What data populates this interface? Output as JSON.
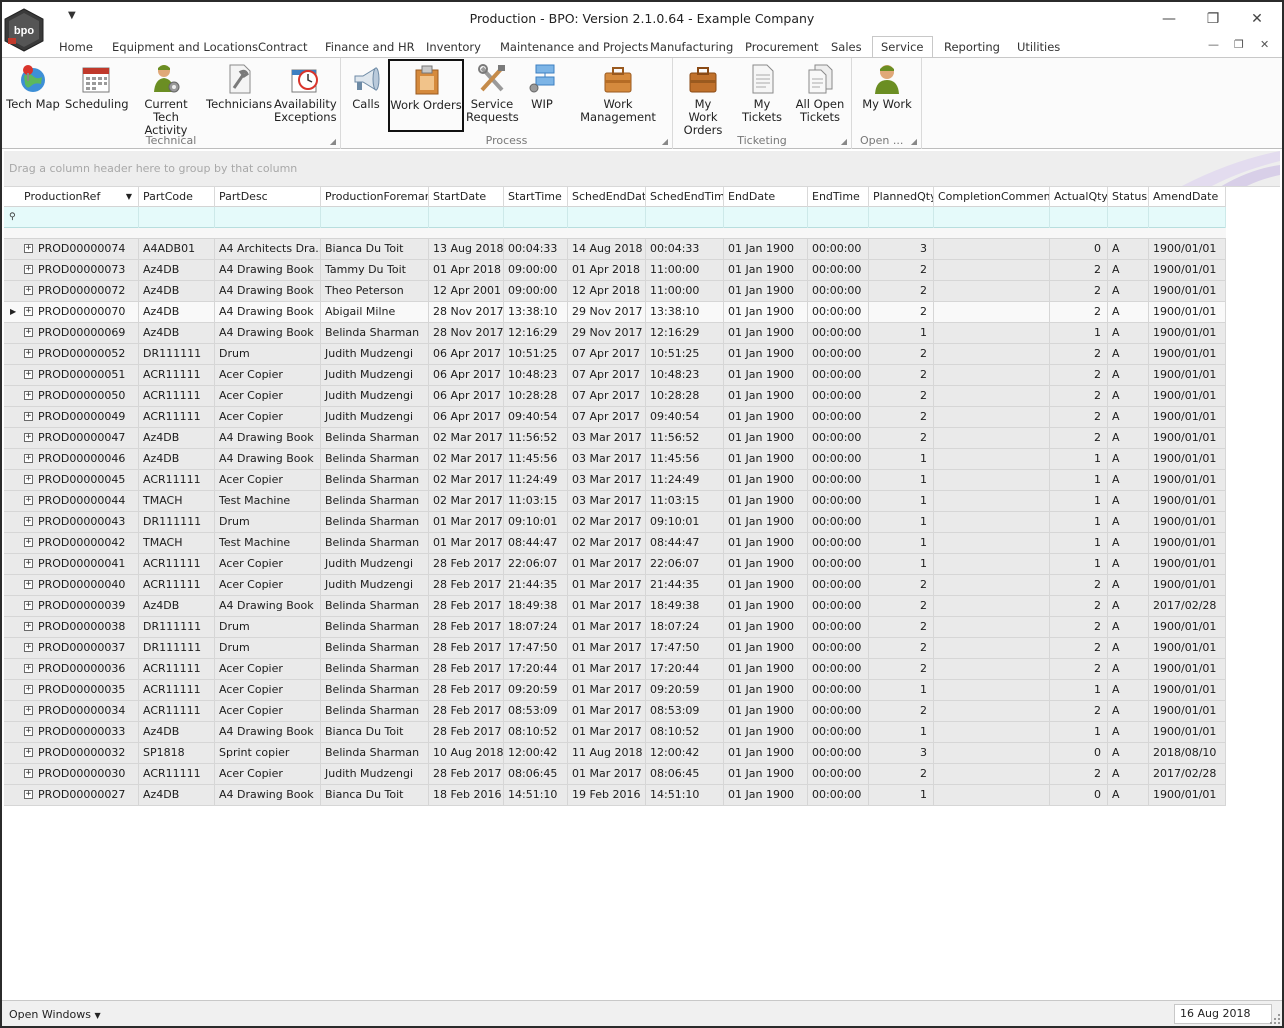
{
  "window": {
    "title": "Production - BPO: Version 2.1.0.64 - Example Company",
    "logo_text": "bpo"
  },
  "tabs": [
    {
      "label": "Home",
      "active": false
    },
    {
      "label": "Equipment and Locations",
      "active": false
    },
    {
      "label": "Contract",
      "active": false
    },
    {
      "label": "Finance and HR",
      "active": false
    },
    {
      "label": "Inventory",
      "active": false
    },
    {
      "label": "Maintenance and Projects",
      "active": false
    },
    {
      "label": "Manufacturing",
      "active": false
    },
    {
      "label": "Procurement",
      "active": false
    },
    {
      "label": "Sales",
      "active": false
    },
    {
      "label": "Service",
      "active": true
    },
    {
      "label": "Reporting",
      "active": false
    },
    {
      "label": "Utilities",
      "active": false
    }
  ],
  "ribbon": {
    "groups": [
      {
        "label": "Technical",
        "buttons": [
          {
            "label": "Tech Map",
            "icon": "globe-pin-icon"
          },
          {
            "label": "Scheduling",
            "icon": "calendar-icon"
          },
          {
            "label": "Current Tech\nActivity",
            "icon": "tech-gear-icon"
          },
          {
            "label": "Technicians",
            "icon": "wrench-document-icon"
          },
          {
            "label": "Availability\nExceptions",
            "icon": "calendar-clock-icon"
          }
        ]
      },
      {
        "label": "Process",
        "buttons": [
          {
            "label": "Calls",
            "icon": "megaphone-icon"
          },
          {
            "label": "Work Orders",
            "icon": "clipboard-icon",
            "selected": true
          },
          {
            "label": "Service\nRequests",
            "icon": "tools-icon"
          },
          {
            "label": "WIP",
            "icon": "workflow-icon"
          },
          {
            "label": "Work Management",
            "icon": "briefcase-icon"
          }
        ]
      },
      {
        "label": "Ticketing",
        "buttons": [
          {
            "label": "My Work\nOrders",
            "icon": "briefcase-icon"
          },
          {
            "label": "My Tickets",
            "icon": "document-icon"
          },
          {
            "label": "All Open\nTickets",
            "icon": "documents-icon"
          }
        ]
      },
      {
        "label": "Open ...",
        "buttons": [
          {
            "label": "My Work",
            "icon": "user-icon"
          }
        ]
      }
    ]
  },
  "group_panel_hint": "Drag a column header here to group by that column",
  "columns": [
    "ProductionRef",
    "PartCode",
    "PartDesc",
    "ProductionForeman",
    "StartDate",
    "StartTime",
    "SchedEndDate",
    "SchedEndTime",
    "EndDate",
    "EndTime",
    "PlannedQty",
    "CompletionComments",
    "ActualQty",
    "Status",
    "AmendDate"
  ],
  "rows": [
    [
      "PROD00000074",
      "A4ADB01",
      "A4 Architects Dra...",
      "Bianca Du Toit",
      "13 Aug 2018",
      "00:04:33",
      "14 Aug 2018",
      "00:04:33",
      "01 Jan 1900",
      "00:00:00",
      "3",
      "",
      "0",
      "A",
      "1900/01/01"
    ],
    [
      "PROD00000073",
      "Az4DB",
      "A4 Drawing Book",
      "Tammy Du Toit",
      "01 Apr 2018",
      "09:00:00",
      "01 Apr 2018",
      "11:00:00",
      "01 Jan 1900",
      "00:00:00",
      "2",
      "",
      "2",
      "A",
      "1900/01/01"
    ],
    [
      "PROD00000072",
      "Az4DB",
      "A4 Drawing Book",
      "Theo Peterson",
      "12 Apr 2001",
      "09:00:00",
      "12 Apr 2018",
      "11:00:00",
      "01 Jan 1900",
      "00:00:00",
      "2",
      "",
      "2",
      "A",
      "1900/01/01"
    ],
    [
      "PROD00000070",
      "Az4DB",
      "A4 Drawing Book",
      "Abigail Milne",
      "28 Nov 2017",
      "13:38:10",
      "29 Nov 2017",
      "13:38:10",
      "01 Jan 1900",
      "00:00:00",
      "2",
      "",
      "2",
      "A",
      "1900/01/01"
    ],
    [
      "PROD00000069",
      "Az4DB",
      "A4 Drawing Book",
      "Belinda Sharman",
      "28 Nov 2017",
      "12:16:29",
      "29 Nov 2017",
      "12:16:29",
      "01 Jan 1900",
      "00:00:00",
      "1",
      "",
      "1",
      "A",
      "1900/01/01"
    ],
    [
      "PROD00000052",
      "DR111111",
      "Drum",
      "Judith Mudzengi",
      "06 Apr 2017",
      "10:51:25",
      "07 Apr 2017",
      "10:51:25",
      "01 Jan 1900",
      "00:00:00",
      "2",
      "",
      "2",
      "A",
      "1900/01/01"
    ],
    [
      "PROD00000051",
      "ACR11111",
      "Acer Copier",
      "Judith Mudzengi",
      "06 Apr 2017",
      "10:48:23",
      "07 Apr 2017",
      "10:48:23",
      "01 Jan 1900",
      "00:00:00",
      "2",
      "",
      "2",
      "A",
      "1900/01/01"
    ],
    [
      "PROD00000050",
      "ACR11111",
      "Acer Copier",
      "Judith Mudzengi",
      "06 Apr 2017",
      "10:28:28",
      "07 Apr 2017",
      "10:28:28",
      "01 Jan 1900",
      "00:00:00",
      "2",
      "",
      "2",
      "A",
      "1900/01/01"
    ],
    [
      "PROD00000049",
      "ACR11111",
      "Acer Copier",
      "Judith Mudzengi",
      "06 Apr 2017",
      "09:40:54",
      "07 Apr 2017",
      "09:40:54",
      "01 Jan 1900",
      "00:00:00",
      "2",
      "",
      "2",
      "A",
      "1900/01/01"
    ],
    [
      "PROD00000047",
      "Az4DB",
      "A4 Drawing Book",
      "Belinda Sharman",
      "02 Mar 2017",
      "11:56:52",
      "03 Mar 2017",
      "11:56:52",
      "01 Jan 1900",
      "00:00:00",
      "2",
      "",
      "2",
      "A",
      "1900/01/01"
    ],
    [
      "PROD00000046",
      "Az4DB",
      "A4 Drawing Book",
      "Belinda Sharman",
      "02 Mar 2017",
      "11:45:56",
      "03 Mar 2017",
      "11:45:56",
      "01 Jan 1900",
      "00:00:00",
      "1",
      "",
      "1",
      "A",
      "1900/01/01"
    ],
    [
      "PROD00000045",
      "ACR11111",
      "Acer Copier",
      "Belinda Sharman",
      "02 Mar 2017",
      "11:24:49",
      "03 Mar 2017",
      "11:24:49",
      "01 Jan 1900",
      "00:00:00",
      "1",
      "",
      "1",
      "A",
      "1900/01/01"
    ],
    [
      "PROD00000044",
      "TMACH",
      "Test Machine",
      "Belinda Sharman",
      "02 Mar 2017",
      "11:03:15",
      "03 Mar 2017",
      "11:03:15",
      "01 Jan 1900",
      "00:00:00",
      "1",
      "",
      "1",
      "A",
      "1900/01/01"
    ],
    [
      "PROD00000043",
      "DR111111",
      "Drum",
      "Belinda Sharman",
      "01 Mar 2017",
      "09:10:01",
      "02 Mar 2017",
      "09:10:01",
      "01 Jan 1900",
      "00:00:00",
      "1",
      "",
      "1",
      "A",
      "1900/01/01"
    ],
    [
      "PROD00000042",
      "TMACH",
      "Test Machine",
      "Belinda Sharman",
      "01 Mar 2017",
      "08:44:47",
      "02 Mar 2017",
      "08:44:47",
      "01 Jan 1900",
      "00:00:00",
      "1",
      "",
      "1",
      "A",
      "1900/01/01"
    ],
    [
      "PROD00000041",
      "ACR11111",
      "Acer Copier",
      "Judith Mudzengi",
      "28 Feb 2017",
      "22:06:07",
      "01 Mar 2017",
      "22:06:07",
      "01 Jan 1900",
      "00:00:00",
      "1",
      "",
      "1",
      "A",
      "1900/01/01"
    ],
    [
      "PROD00000040",
      "ACR11111",
      "Acer Copier",
      "Judith Mudzengi",
      "28 Feb 2017",
      "21:44:35",
      "01 Mar 2017",
      "21:44:35",
      "01 Jan 1900",
      "00:00:00",
      "2",
      "",
      "2",
      "A",
      "1900/01/01"
    ],
    [
      "PROD00000039",
      "Az4DB",
      "A4 Drawing Book",
      "Belinda Sharman",
      "28 Feb 2017",
      "18:49:38",
      "01 Mar 2017",
      "18:49:38",
      "01 Jan 1900",
      "00:00:00",
      "2",
      "",
      "2",
      "A",
      "2017/02/28"
    ],
    [
      "PROD00000038",
      "DR111111",
      "Drum",
      "Belinda Sharman",
      "28 Feb 2017",
      "18:07:24",
      "01 Mar 2017",
      "18:07:24",
      "01 Jan 1900",
      "00:00:00",
      "2",
      "",
      "2",
      "A",
      "1900/01/01"
    ],
    [
      "PROD00000037",
      "DR111111",
      "Drum",
      "Belinda Sharman",
      "28 Feb 2017",
      "17:47:50",
      "01 Mar 2017",
      "17:47:50",
      "01 Jan 1900",
      "00:00:00",
      "2",
      "",
      "2",
      "A",
      "1900/01/01"
    ],
    [
      "PROD00000036",
      "ACR11111",
      "Acer Copier",
      "Belinda Sharman",
      "28 Feb 2017",
      "17:20:44",
      "01 Mar 2017",
      "17:20:44",
      "01 Jan 1900",
      "00:00:00",
      "2",
      "",
      "2",
      "A",
      "1900/01/01"
    ],
    [
      "PROD00000035",
      "ACR11111",
      "Acer Copier",
      "Belinda Sharman",
      "28 Feb 2017",
      "09:20:59",
      "01 Mar 2017",
      "09:20:59",
      "01 Jan 1900",
      "00:00:00",
      "1",
      "",
      "1",
      "A",
      "1900/01/01"
    ],
    [
      "PROD00000034",
      "ACR11111",
      "Acer Copier",
      "Belinda Sharman",
      "28 Feb 2017",
      "08:53:09",
      "01 Mar 2017",
      "08:53:09",
      "01 Jan 1900",
      "00:00:00",
      "2",
      "",
      "2",
      "A",
      "1900/01/01"
    ],
    [
      "PROD00000033",
      "Az4DB",
      "A4 Drawing Book",
      "Bianca Du Toit",
      "28 Feb 2017",
      "08:10:52",
      "01 Mar 2017",
      "08:10:52",
      "01 Jan 1900",
      "00:00:00",
      "1",
      "",
      "1",
      "A",
      "1900/01/01"
    ],
    [
      "PROD00000032",
      "SP1818",
      "Sprint copier",
      "Belinda Sharman",
      "10 Aug 2018",
      "12:00:42",
      "11 Aug 2018",
      "12:00:42",
      "01 Jan 1900",
      "00:00:00",
      "3",
      "",
      "0",
      "A",
      "2018/08/10"
    ],
    [
      "PROD00000030",
      "ACR11111",
      "Acer Copier",
      "Judith Mudzengi",
      "28 Feb 2017",
      "08:06:45",
      "01 Mar 2017",
      "08:06:45",
      "01 Jan 1900",
      "00:00:00",
      "2",
      "",
      "2",
      "A",
      "2017/02/28"
    ],
    [
      "PROD00000027",
      "Az4DB",
      "A4 Drawing Book",
      "Bianca Du Toit",
      "18 Feb 2016",
      "14:51:10",
      "19 Feb 2016",
      "14:51:10",
      "01 Jan 1900",
      "00:00:00",
      "1",
      "",
      "0",
      "A",
      "1900/01/01"
    ]
  ],
  "current_row": 3,
  "status_bar": {
    "open_windows": "Open Windows",
    "date": "16 Aug 2018"
  },
  "colors": {
    "filter_row": "#e5fafa",
    "row_background": "#eaeaea",
    "ribbon_background": "#fbfbfb"
  }
}
